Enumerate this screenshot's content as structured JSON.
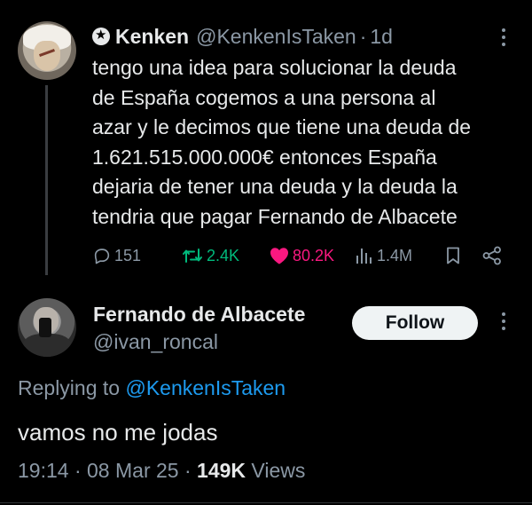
{
  "tweet": {
    "author_name": "Kenken",
    "author_handle": "@KenkenIsTaken",
    "separator": "·",
    "time_ago": "1d",
    "body_lines": [
      "tengo una idea para solucionar la deuda",
      "de España cogemos a una persona al",
      "azar y le decimos que tiene una deuda de",
      "1.621.515.000.000€ entonces España",
      "dejaria de tener una deuda y la deuda la",
      "tendria que pagar Fernando de Albacete"
    ],
    "actions": {
      "replies": "151",
      "reposts": "2.4K",
      "likes": "80.2K",
      "views": "1.4M"
    },
    "icons": {
      "badge": "verified-star-icon",
      "reply": "comment-bubble-icon",
      "repost": "repost-arrows-icon",
      "like": "heart-icon",
      "views": "bar-chart-icon",
      "bookmark": "bookmark-icon",
      "share": "share-icon",
      "more": "more-vertical-icon"
    },
    "colors": {
      "repost": "#00ba7c",
      "like": "#f91880"
    }
  },
  "reply": {
    "author_name": "Fernando de Albacete",
    "author_handle": "@ivan_roncal",
    "follow_label": "Follow",
    "replying_prefix": "Replying to ",
    "replying_mention": "@KenkenIsTaken",
    "text": "vamos no me jodas",
    "time": "19:14",
    "separator": " · ",
    "date": "08 Mar 25",
    "views_count": "149K",
    "views_label": " Views"
  },
  "colors": {
    "background": "#000000",
    "primary_text": "#e7e9ea",
    "secondary_text": "#8b98a5",
    "link": "#1d9bf0"
  }
}
